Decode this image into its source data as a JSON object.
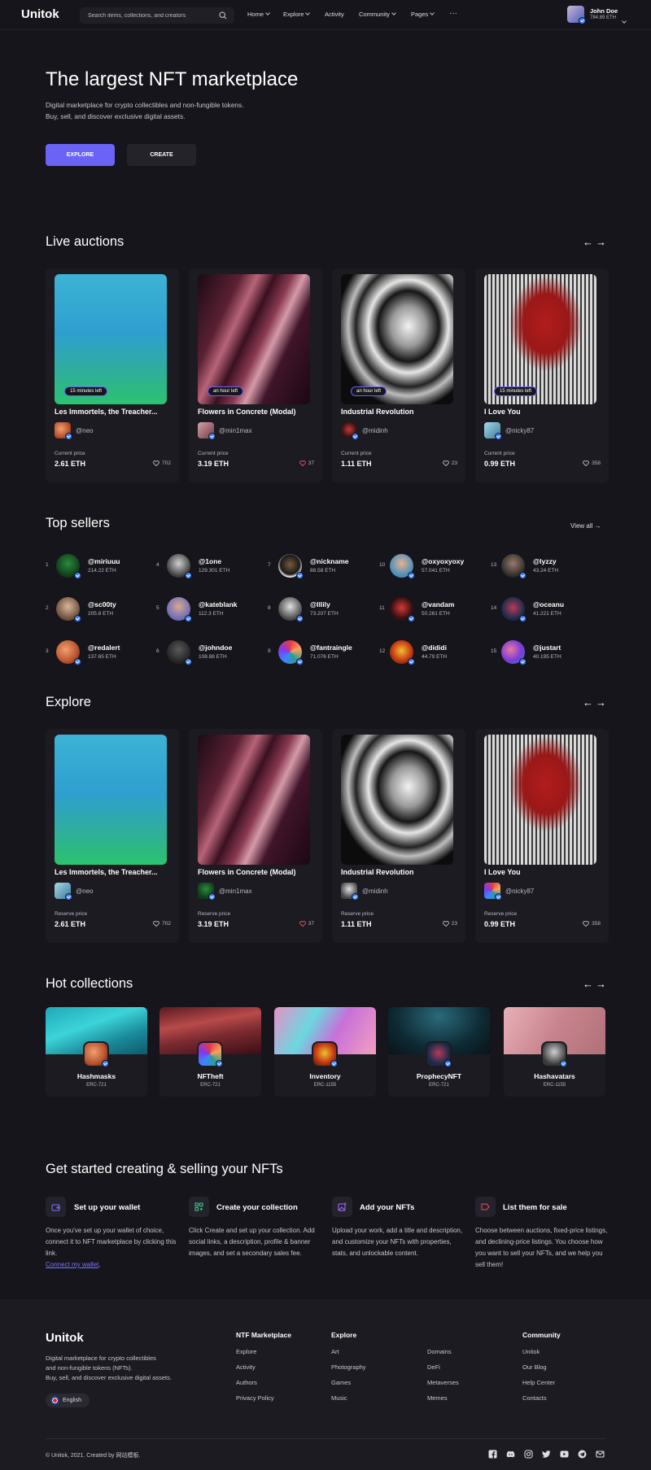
{
  "header": {
    "logo": "Unitok",
    "search_placeholder": "Search items, collections, and creators",
    "nav": [
      "Home",
      "Explore",
      "Activity",
      "Community",
      "Pages"
    ],
    "more": "···",
    "user": {
      "name": "John Doe",
      "balance": "784.89 ETH"
    }
  },
  "hero": {
    "title": "The largest NFT marketplace",
    "subtitle_line1": "Digital marketplace for crypto collectibles and non-fungible tokens.",
    "subtitle_line2": "Buy, sell, and discover exclusive digital assets.",
    "explore_btn": "EXPLORE",
    "create_btn": "CREATE"
  },
  "live_auctions": {
    "title": "Live auctions",
    "items": [
      {
        "name": "Les Immortels, the Treacher...",
        "author": "@neo",
        "time": "15 minutes left",
        "price_label": "Current price",
        "price": "2.61 ETH",
        "likes": "702",
        "liked": false
      },
      {
        "name": "Flowers in Concrete (Modal)",
        "author": "@min1max",
        "time": "an hour left",
        "price_label": "Current price",
        "price": "3.19 ETH",
        "likes": "37",
        "liked": true
      },
      {
        "name": "Industrial Revolution",
        "author": "@midinh",
        "time": "an hour left",
        "price_label": "Current price",
        "price": "1.11 ETH",
        "likes": "23",
        "liked": false
      },
      {
        "name": "I Love You",
        "author": "@nicky87",
        "time": "15 minutes left",
        "price_label": "Current price",
        "price": "0.99 ETH",
        "likes": "358",
        "liked": false
      }
    ]
  },
  "top_sellers": {
    "title": "Top sellers",
    "view_all": "View all",
    "items": [
      {
        "rank": "1",
        "name": "@miriuuu",
        "eth": "214.22 ETH"
      },
      {
        "rank": "2",
        "name": "@sc00ty",
        "eth": "205.8 ETH"
      },
      {
        "rank": "3",
        "name": "@redalert",
        "eth": "137.65 ETH"
      },
      {
        "rank": "4",
        "name": "@1one",
        "eth": "129.301 ETH"
      },
      {
        "rank": "5",
        "name": "@kateblank",
        "eth": "112.3 ETH"
      },
      {
        "rank": "6",
        "name": "@johndoe",
        "eth": "108.88 ETH"
      },
      {
        "rank": "7",
        "name": "@nickname",
        "eth": "88.58 ETH"
      },
      {
        "rank": "8",
        "name": "@lllily",
        "eth": "73.207 ETH"
      },
      {
        "rank": "9",
        "name": "@fantraingle",
        "eth": "71.076 ETH"
      },
      {
        "rank": "10",
        "name": "@oxyoxyoxy",
        "eth": "57.041 ETH"
      },
      {
        "rank": "11",
        "name": "@vandam",
        "eth": "50.261 ETH"
      },
      {
        "rank": "12",
        "name": "@dididi",
        "eth": "44.79 ETH"
      },
      {
        "rank": "13",
        "name": "@lyzzy",
        "eth": "43.24 ETH"
      },
      {
        "rank": "14",
        "name": "@oceanu",
        "eth": "41.221 ETH"
      },
      {
        "rank": "15",
        "name": "@justart",
        "eth": "40.195 ETH"
      }
    ]
  },
  "explore": {
    "title": "Explore",
    "items": [
      {
        "name": "Les Immortels, the Treacher...",
        "author": "@neo",
        "price_label": "Reserve price",
        "price": "2.61 ETH",
        "likes": "702",
        "liked": false
      },
      {
        "name": "Flowers in Concrete (Modal)",
        "author": "@min1max",
        "price_label": "Reserve price",
        "price": "3.19 ETH",
        "likes": "37",
        "liked": true
      },
      {
        "name": "Industrial Revolution",
        "author": "@midinh",
        "price_label": "Reserve price",
        "price": "1.11 ETH",
        "likes": "23",
        "liked": false
      },
      {
        "name": "I Love You",
        "author": "@nicky87",
        "price_label": "Reserve price",
        "price": "0.99 ETH",
        "likes": "358",
        "liked": false
      }
    ]
  },
  "hot_collections": {
    "title": "Hot collections",
    "items": [
      {
        "name": "Hashmasks",
        "type": "ERC-721"
      },
      {
        "name": "NFTheft",
        "type": "ERC-721"
      },
      {
        "name": "Inventory",
        "type": "ERC-1155"
      },
      {
        "name": "ProphecyNFT",
        "type": "ERC-721"
      },
      {
        "name": "Hashavatars",
        "type": "ERC-1155"
      }
    ]
  },
  "get_started": {
    "title": "Get started creating & selling your NFTs",
    "steps": [
      {
        "title": "Set up your wallet",
        "text": "Once you've set up your wallet of choice, connect it to NFT marketplace by clicking this link.",
        "link": "Connect my wallet"
      },
      {
        "title": "Create your collection",
        "text": "Click Create and set up your collection. Add social links, a description, profile & banner images, and set a secondary sales fee."
      },
      {
        "title": "Add your NFTs",
        "text": "Upload your work, add a title and description, and customize your NFTs with properties, stats, and unlockable content."
      },
      {
        "title": "List them for sale",
        "text": "Choose between auctions, fixed-price listings, and declining-price listings. You choose how you want to sell your NFTs, and we help you sell them!"
      }
    ]
  },
  "footer": {
    "logo": "Unitok",
    "desc_line1": "Digital marketplace for crypto collectibles",
    "desc_line2": "and non-fungible tokens (NFTs).",
    "desc_line3": "Buy, sell, and discover exclusive digital assets.",
    "language": "English",
    "columns": [
      {
        "title": "NTF Marketplace",
        "links": [
          "Explore",
          "Activity",
          "Authors",
          "Privacy Policy"
        ]
      },
      {
        "title": "Explore",
        "links": [
          "Art",
          "Photography",
          "Games",
          "Music"
        ]
      },
      {
        "title": "",
        "links": [
          "Domains",
          "DeFi",
          "Metaverses",
          "Memes"
        ]
      },
      {
        "title": "Community",
        "links": [
          "Unitok",
          "Our Blog",
          "Help Center",
          "Contacts"
        ]
      }
    ],
    "copyright": "© Unitok, 2021. Created by 网站模板."
  }
}
